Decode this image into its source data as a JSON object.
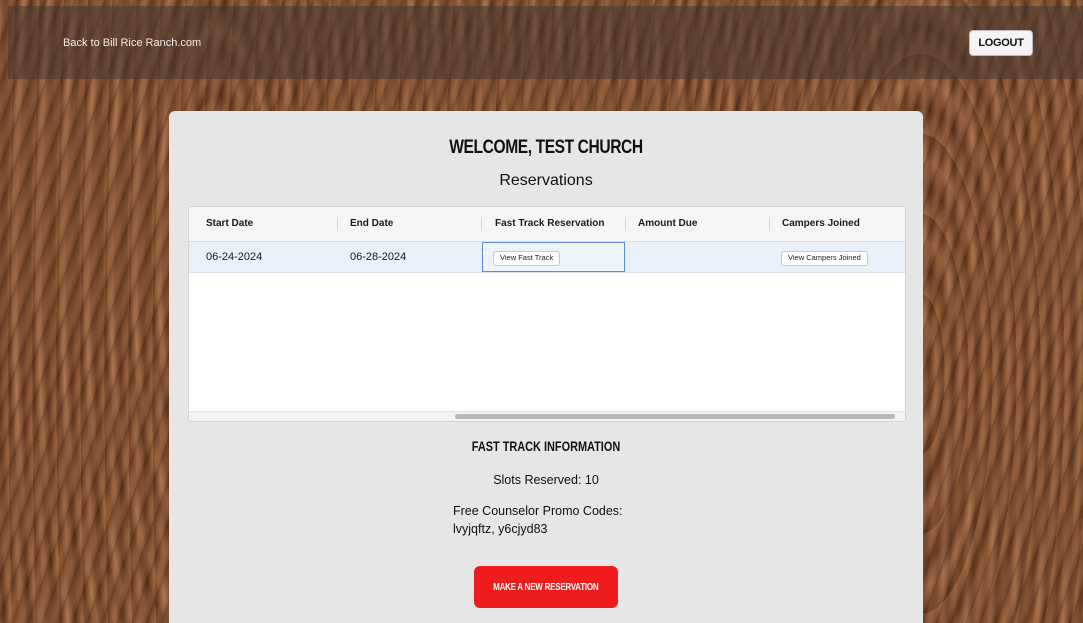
{
  "header": {
    "back_link": "Back to Bill Rice Ranch.com",
    "logout_label": "LOGOUT"
  },
  "panel": {
    "welcome": "WELCOME, TEST CHURCH",
    "reservations_title": "Reservations"
  },
  "table": {
    "columns": [
      "Start Date",
      "End Date",
      "Fast Track Reservation",
      "Amount Due",
      "Campers Joined"
    ],
    "rows": [
      {
        "start_date": "06-24-2024",
        "end_date": "06-28-2024",
        "fast_track_button": "View Fast Track",
        "amount_due": "",
        "campers_button": "View Campers Joined"
      }
    ]
  },
  "fast_track": {
    "title": "FAST TRACK INFORMATION",
    "slots": "Slots Reserved: 10",
    "promo_label": "Free Counselor Promo Codes:",
    "promo_codes": "lvyjqftz, y6cjyd83"
  },
  "actions": {
    "new_reservation": "MAKE A NEW RESERVATION"
  },
  "colors": {
    "accent_red": "#ee1c1c",
    "selected_row": "#e8f0fa",
    "focus_border": "#5b8ed6"
  }
}
